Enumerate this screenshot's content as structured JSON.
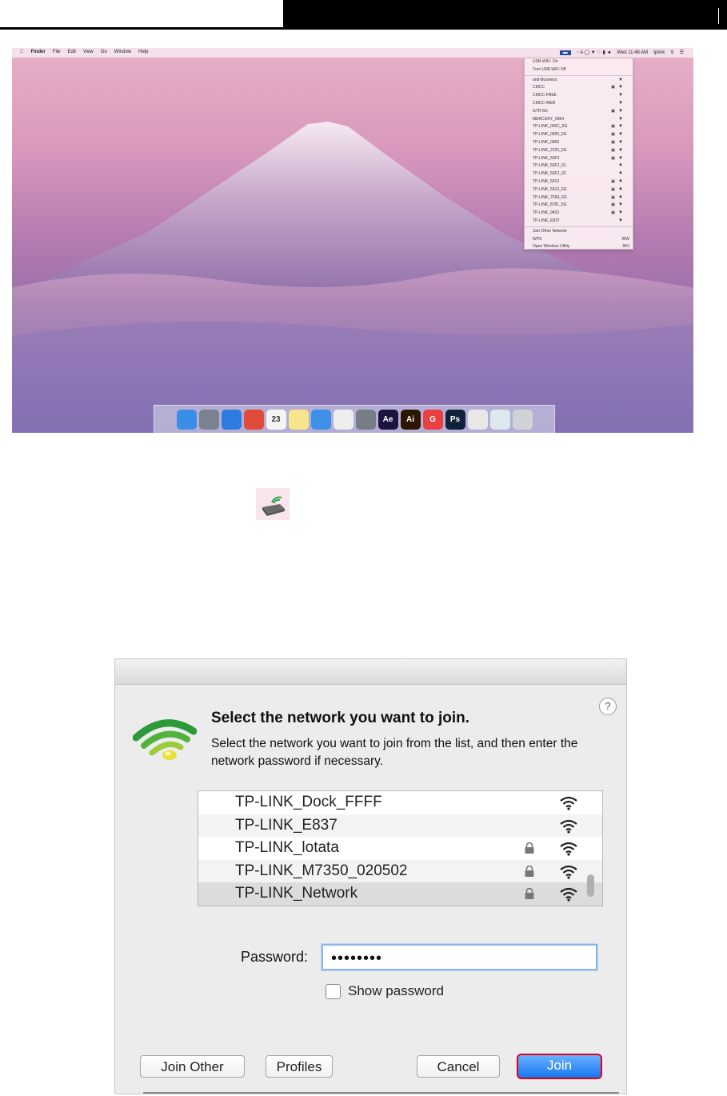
{
  "desktop": {
    "menubar": {
      "apple": "",
      "items": [
        "Finder",
        "File",
        "Edit",
        "View",
        "Go",
        "Window",
        "Help"
      ],
      "status": "Wed 11:48 AM",
      "user": "tplink"
    },
    "wifi_menu": {
      "top": [
        "USB-WiFi: On",
        "Turn USB-WiFi Off"
      ],
      "networks": [
        {
          "name": "and-Business",
          "lock": false
        },
        {
          "name": "CMCC",
          "lock": true
        },
        {
          "name": "CMCC-FREE",
          "lock": false
        },
        {
          "name": "CMCC-WEB",
          "lock": false
        },
        {
          "name": "GTR-5G",
          "lock": true
        },
        {
          "name": "MERCURY_0964",
          "lock": false
        },
        {
          "name": "TP-LINK_000C_5G",
          "lock": true
        },
        {
          "name": "TP-LINK_0050_5G",
          "lock": true
        },
        {
          "name": "TP-LINK_0969",
          "lock": true
        },
        {
          "name": "TP-LINK_2220_5G",
          "lock": true
        },
        {
          "name": "TP-LINK_50F2",
          "lock": true
        },
        {
          "name": "TP-LINK_50F2_01",
          "lock": false
        },
        {
          "name": "TP-LINK_50F2_02",
          "lock": false
        },
        {
          "name": "TP-LINK_5913",
          "lock": true
        },
        {
          "name": "TP-LINK_5913_5G",
          "lock": true
        },
        {
          "name": "TP-LINK_7F66_5G",
          "lock": true
        },
        {
          "name": "TP-LINK_8781_5G",
          "lock": true
        },
        {
          "name": "TP-LINK_9415",
          "lock": true
        },
        {
          "name": "TP-LINK_E837",
          "lock": false
        }
      ],
      "bottom": [
        {
          "label": "Join Other Network",
          "shortcut": ""
        },
        {
          "label": "WPS",
          "shortcut": "⌘W"
        },
        {
          "label": "Open Wireless Utility",
          "shortcut": "⌘O"
        }
      ]
    },
    "dock_icons": [
      {
        "name": "finder",
        "color": "#3a8ee6",
        "text": ""
      },
      {
        "name": "launchpad",
        "color": "#7a8290",
        "text": ""
      },
      {
        "name": "safari",
        "color": "#2f7be0",
        "text": ""
      },
      {
        "name": "chrome",
        "color": "#e14b3b",
        "text": ""
      },
      {
        "name": "calendar",
        "color": "#f5f5f5",
        "text": "23"
      },
      {
        "name": "notes",
        "color": "#f6e58d",
        "text": ""
      },
      {
        "name": "app-store",
        "color": "#3d8fe8",
        "text": ""
      },
      {
        "name": "textedit",
        "color": "#eeeeee",
        "text": ""
      },
      {
        "name": "system-preferences",
        "color": "#777d86",
        "text": ""
      },
      {
        "name": "after-effects",
        "color": "#1c1440",
        "text": "Ae"
      },
      {
        "name": "illustrator",
        "color": "#2b1700",
        "text": "Ai"
      },
      {
        "name": "app-g",
        "color": "#e84040",
        "text": "G"
      },
      {
        "name": "photoshop",
        "color": "#0e2339",
        "text": "Ps"
      },
      {
        "name": "usb-utility",
        "color": "#e8e8e8",
        "text": ""
      },
      {
        "name": "preview",
        "color": "#dde8f0",
        "text": ""
      },
      {
        "name": "trash",
        "color": "#cfd3d8",
        "text": ""
      }
    ]
  },
  "dialog": {
    "help": "?",
    "heading": "Select the network you want to join.",
    "subtext": "Select the network you want to join from the list, and then enter the network password if necessary.",
    "networks": [
      {
        "name": "TP-LINK_Dock_FFFF",
        "lock": false,
        "selected": false
      },
      {
        "name": "TP-LINK_E837",
        "lock": false,
        "selected": false
      },
      {
        "name": "TP-LINK_lotata",
        "lock": true,
        "selected": false
      },
      {
        "name": "TP-LINK_M7350_020502",
        "lock": true,
        "selected": false
      },
      {
        "name": "TP-LINK_Network",
        "lock": true,
        "selected": true
      }
    ],
    "password_label": "Password:",
    "password_value": "••••••••",
    "show_password": "Show password",
    "buttons": {
      "join_other": "Join Other",
      "profiles": "Profiles",
      "cancel": "Cancel",
      "join": "Join"
    },
    "join_highlight_color": "#e3001b"
  }
}
